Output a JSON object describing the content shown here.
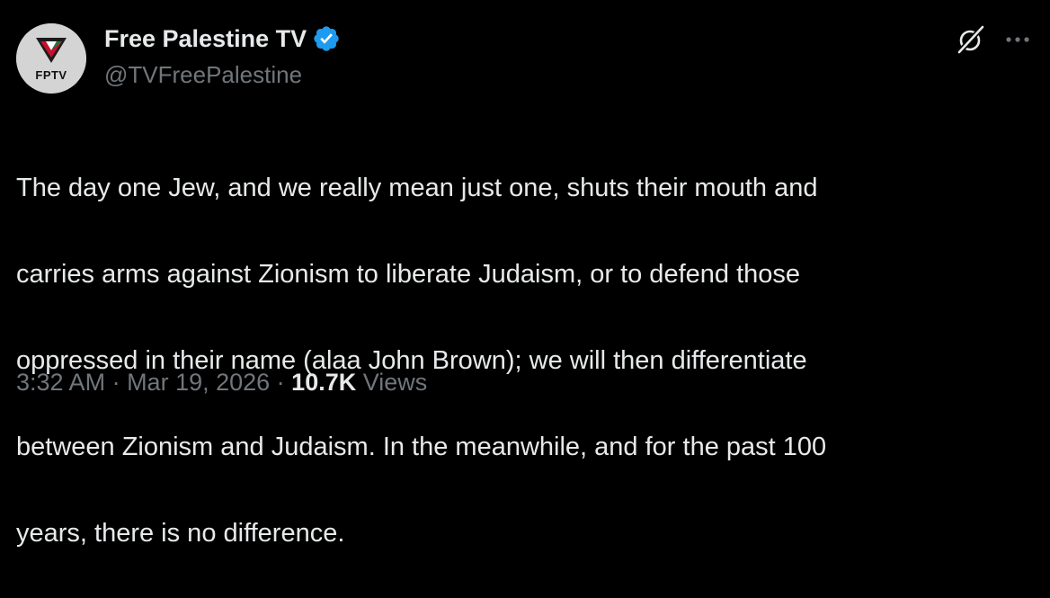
{
  "author": {
    "avatar_text": "FPTV",
    "display_name": "Free Palestine TV",
    "handle": "@TVFreePalestine",
    "verified_color": "#1d9bf0"
  },
  "tweet": {
    "lines": [
      "The day one Jew, and we really mean just one, shuts their mouth and",
      "carries arms against Zionism to liberate Judaism, or to defend those",
      "oppressed in their name (alaa John Brown); we will then differentiate",
      "between Zionism and Judaism. In the meanwhile, and for the past 100",
      "years, there is no difference."
    ]
  },
  "meta": {
    "time": "3:32 AM",
    "separator": " · ",
    "date": "Mar 19, 2026",
    "views_count": "10.7K",
    "views_label": "Views"
  },
  "icons": {
    "grok": "grok-icon",
    "more": "more-icon",
    "verified": "verified-badge-icon"
  },
  "colors": {
    "background": "#000000",
    "text": "#e7e9ea",
    "secondary": "#71767b",
    "accent": "#1d9bf0"
  }
}
